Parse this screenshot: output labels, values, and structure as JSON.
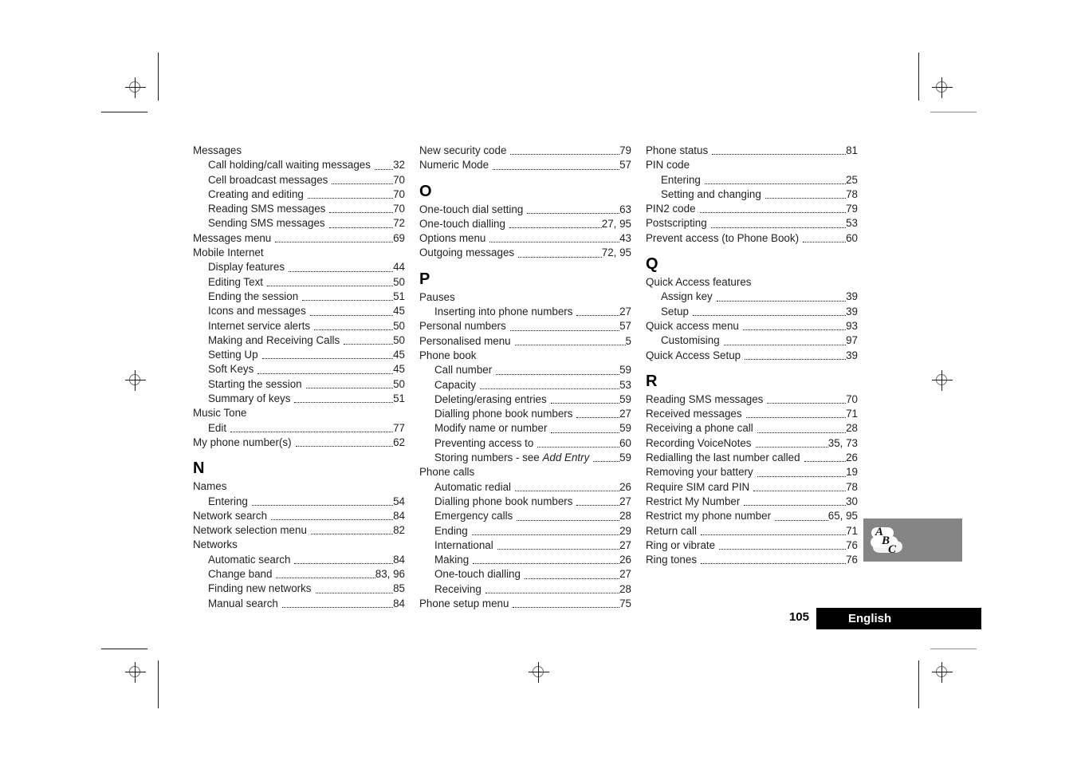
{
  "page": {
    "number": "105",
    "language_label": "English",
    "thumb_icon": "abc-text-entry-icon"
  },
  "columns": [
    {
      "id": "column-1",
      "blocks": [
        {
          "type": "entries",
          "entries": [
            {
              "label": "Messages",
              "page": "",
              "indent": 0
            },
            {
              "label": "Call holding/call waiting messages",
              "page": "32",
              "indent": 1
            },
            {
              "label": "Cell broadcast messages",
              "page": "70",
              "indent": 1
            },
            {
              "label": "Creating and editing",
              "page": "70",
              "indent": 1
            },
            {
              "label": "Reading SMS messages",
              "page": "70",
              "indent": 1
            },
            {
              "label": "Sending SMS messages",
              "page": "72",
              "indent": 1
            },
            {
              "label": "Messages menu",
              "page": "69",
              "indent": 0
            },
            {
              "label": "Mobile Internet",
              "page": "",
              "indent": 0
            },
            {
              "label": "Display features",
              "page": "44",
              "indent": 1
            },
            {
              "label": "Editing Text",
              "page": "50",
              "indent": 1
            },
            {
              "label": "Ending the session",
              "page": "51",
              "indent": 1
            },
            {
              "label": "Icons and messages",
              "page": "45",
              "indent": 1
            },
            {
              "label": "Internet service alerts",
              "page": "50",
              "indent": 1
            },
            {
              "label": "Making and Receiving Calls",
              "page": "50",
              "indent": 1
            },
            {
              "label": "Setting Up",
              "page": "45",
              "indent": 1
            },
            {
              "label": "Soft Keys",
              "page": "45",
              "indent": 1
            },
            {
              "label": "Starting the session",
              "page": "50",
              "indent": 1
            },
            {
              "label": "Summary of keys",
              "page": "51",
              "indent": 1
            },
            {
              "label": "Music Tone",
              "page": "",
              "indent": 0
            },
            {
              "label": "Edit",
              "page": "77",
              "indent": 1
            },
            {
              "label": "My phone number(s)",
              "page": "62",
              "indent": 0
            }
          ]
        },
        {
          "type": "letter",
          "letter": "N"
        },
        {
          "type": "entries",
          "entries": [
            {
              "label": "Names",
              "page": "",
              "indent": 0
            },
            {
              "label": "Entering",
              "page": "54",
              "indent": 1
            },
            {
              "label": "Network search",
              "page": "84",
              "indent": 0
            },
            {
              "label": "Network selection menu",
              "page": "82",
              "indent": 0
            },
            {
              "label": "Networks",
              "page": "",
              "indent": 0
            },
            {
              "label": "Automatic search",
              "page": "84",
              "indent": 1
            },
            {
              "label": "Change band",
              "page": "83, 96",
              "indent": 1
            },
            {
              "label": "Finding new networks",
              "page": "85",
              "indent": 1
            },
            {
              "label": "Manual search",
              "page": "84",
              "indent": 1
            }
          ]
        }
      ]
    },
    {
      "id": "column-2",
      "blocks": [
        {
          "type": "entries",
          "entries": [
            {
              "label": "New security code",
              "page": "79",
              "indent": 0
            },
            {
              "label": "Numeric Mode",
              "page": "57",
              "indent": 0
            }
          ]
        },
        {
          "type": "letter",
          "letter": "O"
        },
        {
          "type": "entries",
          "entries": [
            {
              "label": "One-touch dial setting",
              "page": "63",
              "indent": 0
            },
            {
              "label": "One-touch dialling",
              "page": "27, 95",
              "indent": 0
            },
            {
              "label": "Options menu",
              "page": "43",
              "indent": 0
            },
            {
              "label": "Outgoing messages",
              "page": "72, 95",
              "indent": 0
            }
          ]
        },
        {
          "type": "letter",
          "letter": "P"
        },
        {
          "type": "entries",
          "entries": [
            {
              "label": "Pauses",
              "page": "",
              "indent": 0
            },
            {
              "label": "Inserting into phone numbers",
              "page": "27",
              "indent": 1
            },
            {
              "label": "Personal numbers",
              "page": "57",
              "indent": 0
            },
            {
              "label": "Personalised menu",
              "page": "5",
              "indent": 0
            },
            {
              "label": "Phone book",
              "page": "",
              "indent": 0
            },
            {
              "label": "Call number",
              "page": "59",
              "indent": 1
            },
            {
              "label": "Capacity",
              "page": "53",
              "indent": 1
            },
            {
              "label": "Deleting/erasing entries",
              "page": "59",
              "indent": 1
            },
            {
              "label": "Dialling phone book numbers",
              "page": "27",
              "indent": 1
            },
            {
              "label": "Modify name or number",
              "page": "59",
              "indent": 1
            },
            {
              "label": "Preventing access to",
              "page": "60",
              "indent": 1
            },
            {
              "label": "Storing numbers - see ",
              "italic": "Add Entry",
              "page": "59",
              "indent": 1
            },
            {
              "label": "Phone calls",
              "page": "",
              "indent": 0
            },
            {
              "label": "Automatic redial",
              "page": "26",
              "indent": 1
            },
            {
              "label": "Dialling phone book numbers",
              "page": "27",
              "indent": 1
            },
            {
              "label": "Emergency calls",
              "page": "28",
              "indent": 1
            },
            {
              "label": "Ending",
              "page": "29",
              "indent": 1
            },
            {
              "label": "International",
              "page": "27",
              "indent": 1
            },
            {
              "label": "Making",
              "page": "26",
              "indent": 1
            },
            {
              "label": "One-touch dialling",
              "page": "27",
              "indent": 1
            },
            {
              "label": "Receiving",
              "page": "28",
              "indent": 1
            },
            {
              "label": "Phone setup menu",
              "page": "75",
              "indent": 0
            }
          ]
        }
      ]
    },
    {
      "id": "column-3",
      "blocks": [
        {
          "type": "entries",
          "entries": [
            {
              "label": "Phone status",
              "page": "81",
              "indent": 0
            },
            {
              "label": "PIN code",
              "page": "",
              "indent": 0
            },
            {
              "label": "Entering",
              "page": "25",
              "indent": 1
            },
            {
              "label": "Setting and changing",
              "page": "78",
              "indent": 1
            },
            {
              "label": "PIN2 code",
              "page": "79",
              "indent": 0
            },
            {
              "label": "Postscripting",
              "page": "53",
              "indent": 0
            },
            {
              "label": "Prevent access (to Phone Book)",
              "page": "60",
              "indent": 0
            }
          ]
        },
        {
          "type": "letter",
          "letter": "Q"
        },
        {
          "type": "entries",
          "entries": [
            {
              "label": "Quick Access features",
              "page": "",
              "indent": 0
            },
            {
              "label": "Assign key",
              "page": "39",
              "indent": 1
            },
            {
              "label": "Setup",
              "page": "39",
              "indent": 1
            },
            {
              "label": "Quick access menu",
              "page": "93",
              "indent": 0
            },
            {
              "label": "Customising",
              "page": "97",
              "indent": 1
            },
            {
              "label": "Quick Access Setup",
              "page": "39",
              "indent": 0
            }
          ]
        },
        {
          "type": "letter",
          "letter": "R"
        },
        {
          "type": "entries",
          "entries": [
            {
              "label": "Reading SMS messages",
              "page": "70",
              "indent": 0
            },
            {
              "label": "Received messages",
              "page": "71",
              "indent": 0
            },
            {
              "label": "Receiving a phone call",
              "page": "28",
              "indent": 0
            },
            {
              "label": "Recording VoiceNotes",
              "page": "35, 73",
              "indent": 0
            },
            {
              "label": "Redialling the last number called",
              "page": "26",
              "indent": 0
            },
            {
              "label": "Removing your battery",
              "page": "19",
              "indent": 0
            },
            {
              "label": "Require SIM card PIN",
              "page": "78",
              "indent": 0
            },
            {
              "label": "Restrict My Number",
              "page": "30",
              "indent": 0
            },
            {
              "label": "Restrict my phone number",
              "page": "65, 95",
              "indent": 0
            },
            {
              "label": "Return call",
              "page": "71",
              "indent": 0
            },
            {
              "label": "Ring or vibrate",
              "page": "76",
              "indent": 0
            },
            {
              "label": "Ring tones",
              "page": "76",
              "indent": 0
            }
          ]
        }
      ]
    }
  ]
}
